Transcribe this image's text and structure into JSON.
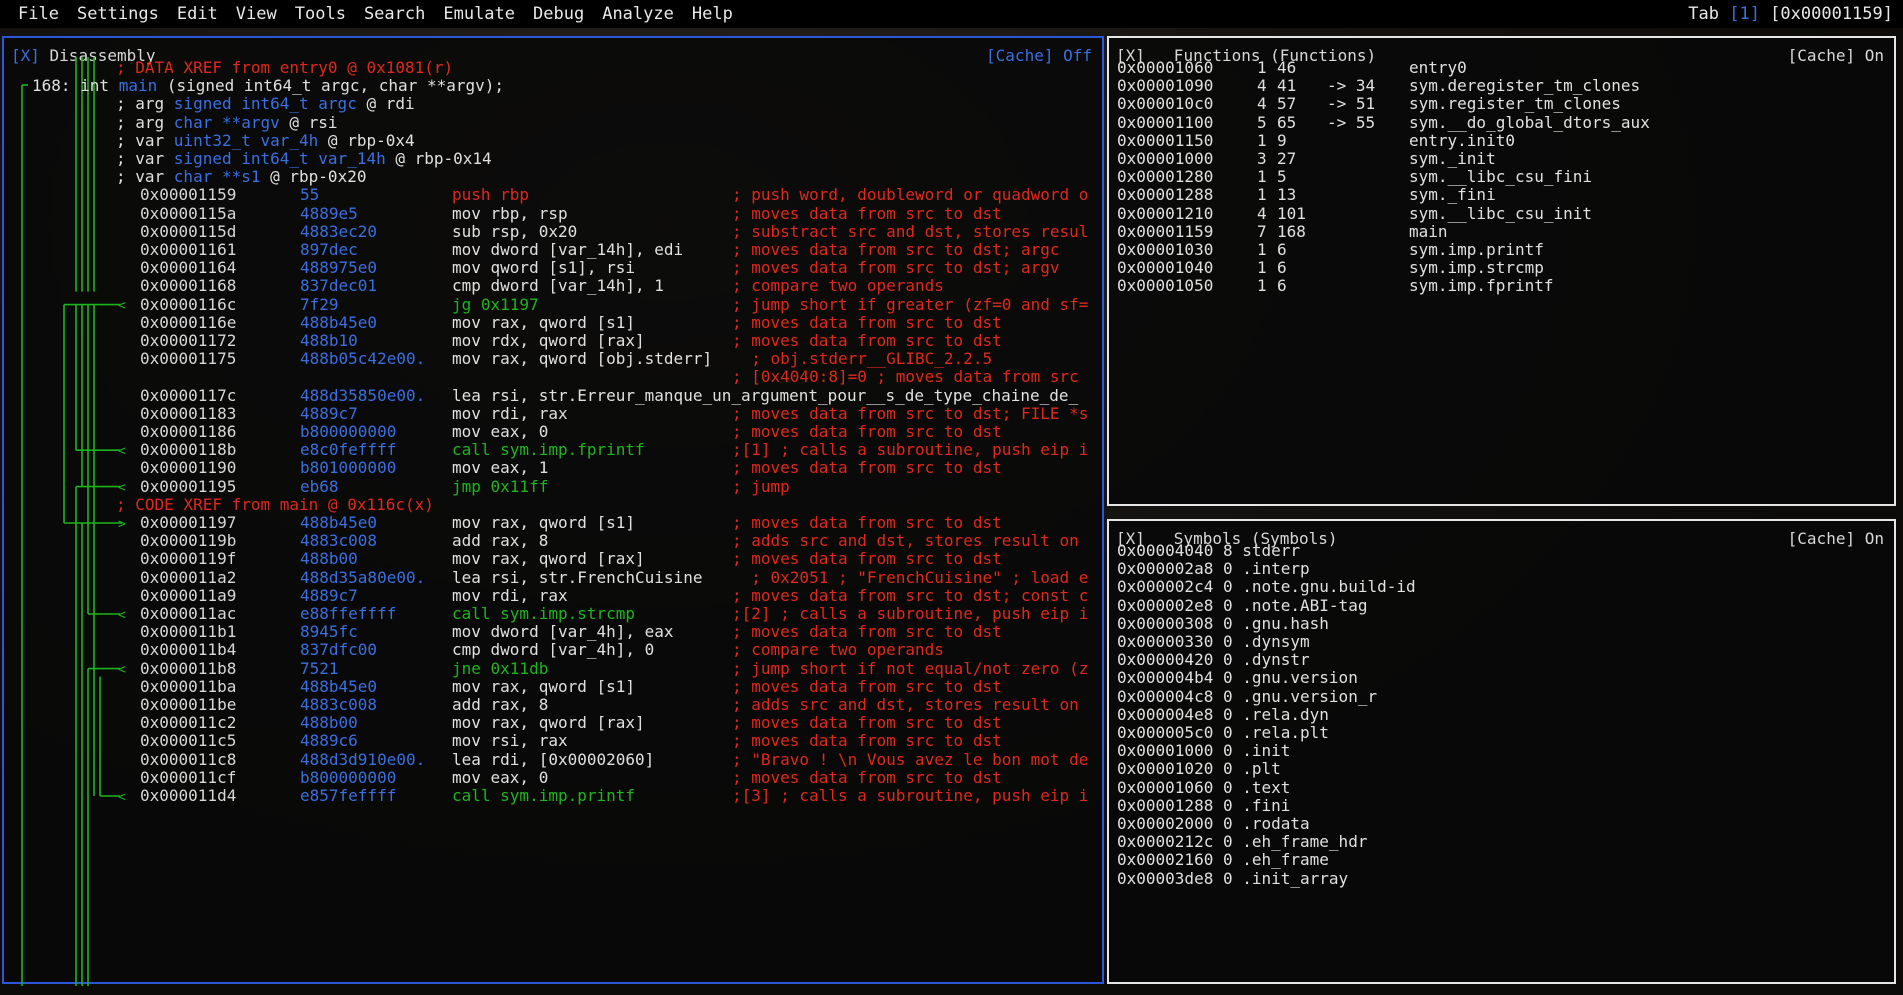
{
  "menubar": {
    "items": [
      "File",
      "Settings",
      "Edit",
      "View",
      "Tools",
      "Search",
      "Emulate",
      "Debug",
      "Analyze",
      "Help"
    ],
    "tab_label": "Tab ",
    "tab_index": "[1]",
    "tab_addr": " [0x00001159]"
  },
  "disasm": {
    "title_prefix": "[X]",
    "title": " Disassembly",
    "cache_label": "[Cache]",
    "cache_state": " Off",
    "header_lines": [
      {
        "text": "; DATA XREF from entry0 @ 0x1081(r)",
        "cls": "red"
      },
      {
        "text": "168: int main (signed int64_t argc, char **argv);",
        "cls": "func"
      },
      {
        "pre": "; arg ",
        "type": "signed int64_t argc",
        "post": " @ rdi"
      },
      {
        "pre": "; arg ",
        "type": "char **argv",
        "post": " @ rsi"
      },
      {
        "pre": "; var ",
        "type": "uint32_t var_4h",
        "post": " @ rbp-0x4"
      },
      {
        "pre": "; var ",
        "type": "signed int64_t var_14h",
        "post": " @ rbp-0x14"
      },
      {
        "pre": "; var ",
        "type": "char **s1",
        "post": " @ rbp-0x20"
      }
    ],
    "lines": [
      {
        "addr": "0x00001159",
        "bytes": "55",
        "op": "push rbp",
        "opc": "red",
        "cmt": "; push word, doubleword or quadword o"
      },
      {
        "addr": "0x0000115a",
        "bytes": "4889e5",
        "op": "mov rbp, rsp",
        "opc": "white",
        "cmt": "; moves data from src to dst"
      },
      {
        "addr": "0x0000115d",
        "bytes": "4883ec20",
        "op": "sub rsp, 0x20",
        "opc": "white",
        "cmt": "; substract src and dst, stores resul"
      },
      {
        "addr": "0x00001161",
        "bytes": "897dec",
        "op": "mov dword [var_14h], edi",
        "opc": "white",
        "cmt": "; moves data from src to dst; argc"
      },
      {
        "addr": "0x00001164",
        "bytes": "488975e0",
        "op": "mov qword [s1], rsi",
        "opc": "white",
        "cmt": "; moves data from src to dst; argv"
      },
      {
        "addr": "0x00001168",
        "bytes": "837dec01",
        "op": "cmp dword [var_14h], 1",
        "opc": "white",
        "cmt": "; compare two operands"
      },
      {
        "addr": "0x0000116c",
        "bytes": "7f29",
        "op": "jg 0x1197",
        "opc": "green",
        "cmt": "; jump short if greater (zf=0 and sf=",
        "arrow": true
      },
      {
        "addr": "0x0000116e",
        "bytes": "488b45e0",
        "op": "mov rax, qword [s1]",
        "opc": "white",
        "cmt": "; moves data from src to dst"
      },
      {
        "addr": "0x00001172",
        "bytes": "488b10",
        "op": "mov rdx, qword [rax]",
        "opc": "white",
        "cmt": "; moves data from src to dst"
      },
      {
        "addr": "0x00001175",
        "bytes": "488b05c42e00.",
        "op": "mov rax, qword [obj.stderr]",
        "opc": "white",
        "cmt": "  ; obj.stderr__GLIBC_2.2.5"
      },
      {
        "addr": "",
        "bytes": "",
        "op": "",
        "opc": "white",
        "cmt": "; [0x4040:8]=0 ; moves data from src"
      },
      {
        "addr": "0x0000117c",
        "bytes": "488d35850e00.",
        "op": "lea rsi, str.Erreur_manque_un_argument_pour__s_de_type_chaine_de_",
        "opc": "white",
        "cmt": ""
      },
      {
        "addr": "0x00001183",
        "bytes": "4889c7",
        "op": "mov rdi, rax",
        "opc": "white",
        "cmt": "; moves data from src to dst; FILE *s"
      },
      {
        "addr": "0x00001186",
        "bytes": "b800000000",
        "op": "mov eax, 0",
        "opc": "white",
        "cmt": "; moves data from src to dst"
      },
      {
        "addr": "0x0000118b",
        "bytes": "e8c0feffff",
        "op": "call sym.imp.fprintf",
        "opc": "green",
        "cmt": ";[1] ; calls a subroutine, push eip i",
        "arrow": true
      },
      {
        "addr": "0x00001190",
        "bytes": "b801000000",
        "op": "mov eax, 1",
        "opc": "white",
        "cmt": "; moves data from src to dst"
      },
      {
        "addr": "0x00001195",
        "bytes": "eb68",
        "op": "jmp 0x11ff",
        "opc": "green",
        "cmt": "; jump",
        "arrow": true
      },
      {
        "xref": "; CODE XREF from main @ 0x116c(x)"
      },
      {
        "addr": "0x00001197",
        "bytes": "488b45e0",
        "op": "mov rax, qword [s1]",
        "opc": "white",
        "cmt": "; moves data from src to dst",
        "arrowin": true
      },
      {
        "addr": "0x0000119b",
        "bytes": "4883c008",
        "op": "add rax, 8",
        "opc": "white",
        "cmt": "; adds src and dst, stores result on"
      },
      {
        "addr": "0x0000119f",
        "bytes": "488b00",
        "op": "mov rax, qword [rax]",
        "opc": "white",
        "cmt": "; moves data from src to dst"
      },
      {
        "addr": "0x000011a2",
        "bytes": "488d35a80e00.",
        "op": "lea rsi, str.FrenchCuisine",
        "opc": "white",
        "cmt": "  ; 0x2051 ; \"FrenchCuisine\" ; load e"
      },
      {
        "addr": "0x000011a9",
        "bytes": "4889c7",
        "op": "mov rdi, rax",
        "opc": "white",
        "cmt": "; moves data from src to dst; const c"
      },
      {
        "addr": "0x000011ac",
        "bytes": "e88ffeffff",
        "op": "call sym.imp.strcmp",
        "opc": "green",
        "cmt": ";[2] ; calls a subroutine, push eip i",
        "arrow": true
      },
      {
        "addr": "0x000011b1",
        "bytes": "8945fc",
        "op": "mov dword [var_4h], eax",
        "opc": "white",
        "cmt": "; moves data from src to dst"
      },
      {
        "addr": "0x000011b4",
        "bytes": "837dfc00",
        "op": "cmp dword [var_4h], 0",
        "opc": "white",
        "cmt": "; compare two operands"
      },
      {
        "addr": "0x000011b8",
        "bytes": "7521",
        "op": "jne 0x11db",
        "opc": "green",
        "cmt": "; jump short if not equal/not zero (z",
        "arrow": true
      },
      {
        "addr": "0x000011ba",
        "bytes": "488b45e0",
        "op": "mov rax, qword [s1]",
        "opc": "white",
        "cmt": "; moves data from src to dst"
      },
      {
        "addr": "0x000011be",
        "bytes": "4883c008",
        "op": "add rax, 8",
        "opc": "white",
        "cmt": "; adds src and dst, stores result on"
      },
      {
        "addr": "0x000011c2",
        "bytes": "488b00",
        "op": "mov rax, qword [rax]",
        "opc": "white",
        "cmt": "; moves data from src to dst"
      },
      {
        "addr": "0x000011c5",
        "bytes": "4889c6",
        "op": "mov rsi, rax",
        "opc": "white",
        "cmt": "; moves data from src to dst"
      },
      {
        "addr": "0x000011c8",
        "bytes": "488d3d910e00.",
        "op": "lea rdi, [0x00002060]",
        "opc": "white",
        "cmt": "; \"Bravo ! \\n Vous avez le bon mot de"
      },
      {
        "addr": "0x000011cf",
        "bytes": "b800000000",
        "op": "mov eax, 0",
        "opc": "white",
        "cmt": "; moves data from src to dst"
      },
      {
        "addr": "0x000011d4",
        "bytes": "e857feffff",
        "op": "call sym.imp.printf",
        "opc": "green",
        "cmt": ";[3] ; calls a subroutine, push eip i",
        "arrow": true
      }
    ]
  },
  "functions": {
    "title_prefix": "[X]",
    "title": "   Functions (Functions)",
    "cache_label": "[Cache]",
    "cache_state": " On",
    "rows": [
      {
        "addr": "0x00001060",
        "nbbs": "1",
        "size": "46",
        "xref": "",
        "name": "entry0"
      },
      {
        "addr": "0x00001090",
        "nbbs": "4",
        "size": "41",
        "xref": "-> 34",
        "name": "sym.deregister_tm_clones"
      },
      {
        "addr": "0x000010c0",
        "nbbs": "4",
        "size": "57",
        "xref": "-> 51",
        "name": "sym.register_tm_clones"
      },
      {
        "addr": "0x00001100",
        "nbbs": "5",
        "size": "65",
        "xref": "-> 55",
        "name": "sym.__do_global_dtors_aux"
      },
      {
        "addr": "0x00001150",
        "nbbs": "1",
        "size": "9",
        "xref": "",
        "name": "entry.init0"
      },
      {
        "addr": "0x00001000",
        "nbbs": "3",
        "size": "27",
        "xref": "",
        "name": "sym._init"
      },
      {
        "addr": "0x00001280",
        "nbbs": "1",
        "size": "5",
        "xref": "",
        "name": "sym.__libc_csu_fini"
      },
      {
        "addr": "0x00001288",
        "nbbs": "1",
        "size": "13",
        "xref": "",
        "name": "sym._fini"
      },
      {
        "addr": "0x00001210",
        "nbbs": "4",
        "size": "101",
        "xref": "",
        "name": "sym.__libc_csu_init"
      },
      {
        "addr": "0x00001159",
        "nbbs": "7",
        "size": "168",
        "xref": "",
        "name": "main"
      },
      {
        "addr": "0x00001030",
        "nbbs": "1",
        "size": "6",
        "xref": "",
        "name": "sym.imp.printf"
      },
      {
        "addr": "0x00001040",
        "nbbs": "1",
        "size": "6",
        "xref": "",
        "name": "sym.imp.strcmp"
      },
      {
        "addr": "0x00001050",
        "nbbs": "1",
        "size": "6",
        "xref": "",
        "name": "sym.imp.fprintf"
      }
    ]
  },
  "symbols": {
    "title_prefix": "[X]",
    "title": "   Symbols (Symbols)",
    "cache_label": "[Cache]",
    "cache_state": " On",
    "rows": [
      "0x00004040 8 stderr",
      "0x000002a8 0 .interp",
      "0x000002c4 0 .note.gnu.build-id",
      "0x000002e8 0 .note.ABI-tag",
      "0x00000308 0 .gnu.hash",
      "0x00000330 0 .dynsym",
      "0x00000420 0 .dynstr",
      "0x000004b4 0 .gnu.version",
      "0x000004c8 0 .gnu.version_r",
      "0x000004e8 0 .rela.dyn",
      "0x000005c0 0 .rela.plt",
      "0x00001000 0 .init",
      "0x00001020 0 .plt",
      "0x00001060 0 .text",
      "0x00001288 0 .fini",
      "0x00002000 0 .rodata",
      "0x0000212c 0 .eh_frame_hdr",
      "0x00002160 0 .eh_frame",
      "0x00003de8 0 .init_array"
    ]
  },
  "colors": {
    "accent": "#2e56d8",
    "green": "#1db51d",
    "red": "#e0281d",
    "bytes": "#3b6fe0"
  }
}
